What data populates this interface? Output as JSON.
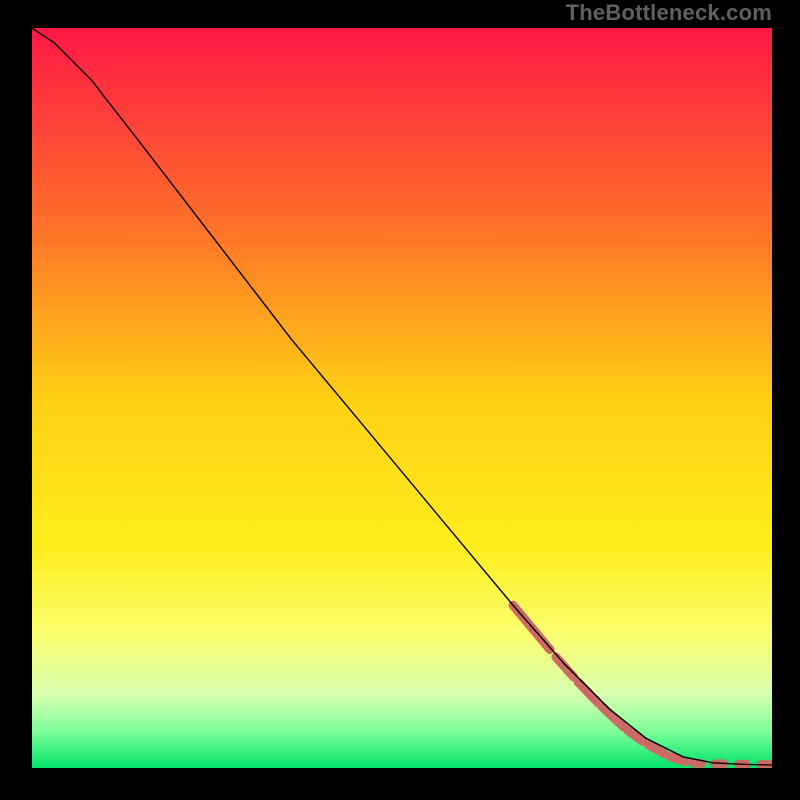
{
  "attribution": "TheBottleneck.com",
  "chart_data": {
    "type": "line",
    "title": "",
    "xlabel": "",
    "ylabel": "",
    "xlim": [
      0,
      100
    ],
    "ylim": [
      0,
      100
    ],
    "grid": false,
    "legend": false,
    "background_gradient": {
      "stops": [
        {
          "offset": 0.0,
          "color": "#ff1846"
        },
        {
          "offset": 0.25,
          "color": "#ff6a2c"
        },
        {
          "offset": 0.5,
          "color": "#ffcf14"
        },
        {
          "offset": 0.7,
          "color": "#ffee1c"
        },
        {
          "offset": 0.82,
          "color": "#fbff70"
        },
        {
          "offset": 0.9,
          "color": "#d8ffb0"
        },
        {
          "offset": 0.95,
          "color": "#7eff9a"
        },
        {
          "offset": 1.0,
          "color": "#00e36a"
        }
      ]
    },
    "series": [
      {
        "name": "curve",
        "stroke": "#000000",
        "stroke_width": 1.4,
        "points": [
          {
            "x": 0,
            "y": 100
          },
          {
            "x": 3,
            "y": 98
          },
          {
            "x": 8,
            "y": 93
          },
          {
            "x": 15,
            "y": 84
          },
          {
            "x": 25,
            "y": 71
          },
          {
            "x": 35,
            "y": 58
          },
          {
            "x": 45,
            "y": 46
          },
          {
            "x": 55,
            "y": 34
          },
          {
            "x": 65,
            "y": 22
          },
          {
            "x": 72,
            "y": 14
          },
          {
            "x": 78,
            "y": 8
          },
          {
            "x": 83,
            "y": 4
          },
          {
            "x": 88,
            "y": 1.5
          },
          {
            "x": 92,
            "y": 0.7
          },
          {
            "x": 96,
            "y": 0.5
          },
          {
            "x": 100,
            "y": 0.4
          }
        ]
      }
    ],
    "overlay_segments": {
      "stroke": "#cc6b66",
      "stroke_width": 9,
      "linecap": "round",
      "segments": [
        {
          "x1": 65,
          "y1": 22,
          "x2": 70,
          "y2": 16
        },
        {
          "x1": 70.8,
          "y1": 15,
          "x2": 73.2,
          "y2": 12.3
        },
        {
          "x1": 73.8,
          "y1": 11.6,
          "x2": 76.5,
          "y2": 8.8
        },
        {
          "x1": 77,
          "y1": 8.3,
          "x2": 80,
          "y2": 5.5
        },
        {
          "x1": 80.5,
          "y1": 5.1,
          "x2": 82.5,
          "y2": 3.6
        },
        {
          "x1": 83.3,
          "y1": 3.1,
          "x2": 85.5,
          "y2": 1.9
        },
        {
          "x1": 86.3,
          "y1": 1.5,
          "x2": 88.2,
          "y2": 0.9
        },
        {
          "x1": 89.3,
          "y1": 0.7,
          "x2": 90.5,
          "y2": 0.6
        },
        {
          "x1": 92.3,
          "y1": 0.55,
          "x2": 93.5,
          "y2": 0.55
        },
        {
          "x1": 95.5,
          "y1": 0.5,
          "x2": 96.5,
          "y2": 0.5
        },
        {
          "x1": 98.5,
          "y1": 0.45,
          "x2": 99.8,
          "y2": 0.45
        }
      ]
    }
  }
}
